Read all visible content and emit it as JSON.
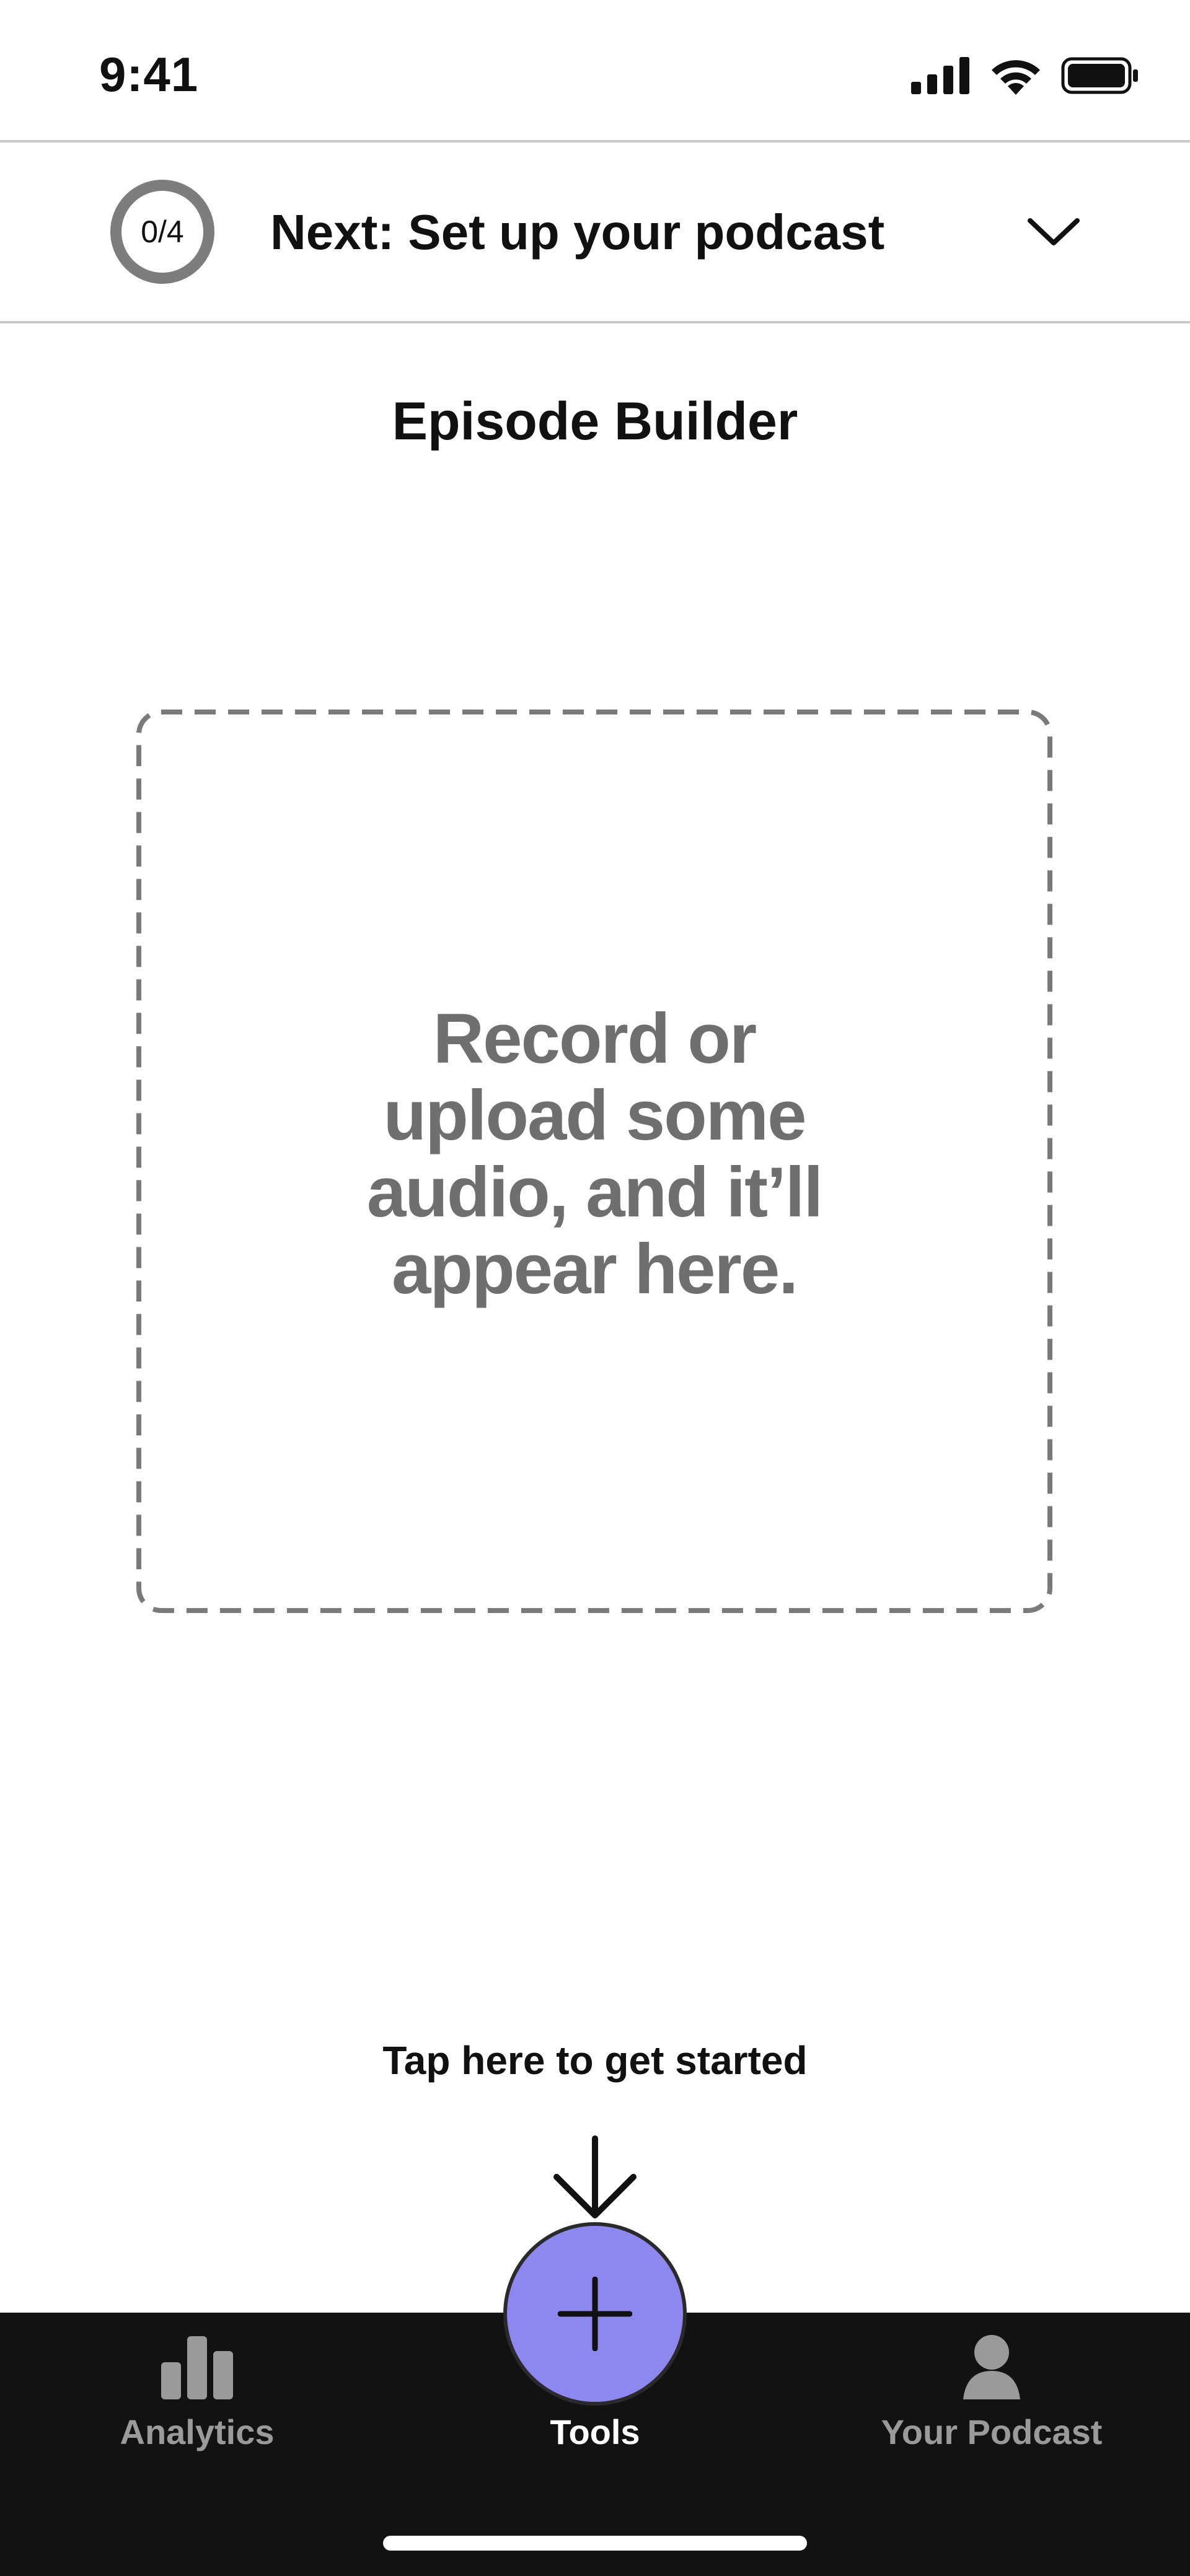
{
  "status_bar": {
    "time": "9:41"
  },
  "onboarding": {
    "progress_text": "0/4",
    "next_step": "Next: Set up your podcast"
  },
  "page": {
    "title": "Episode Builder"
  },
  "dropzone": {
    "lines": [
      "Record or",
      "upload some",
      "audio, and it’ll",
      "appear here."
    ]
  },
  "hint": {
    "text": "Tap here to get started"
  },
  "tabs": [
    {
      "label": "Analytics",
      "icon": "bar-chart-icon",
      "active": false
    },
    {
      "label": "Tools",
      "icon": "plus-icon",
      "active": true
    },
    {
      "label": "Your Podcast",
      "icon": "person-icon",
      "active": false
    }
  ],
  "colors": {
    "accent": "#8d87f0",
    "tabbar": "#121212",
    "muted_text": "#6f6f6f"
  }
}
